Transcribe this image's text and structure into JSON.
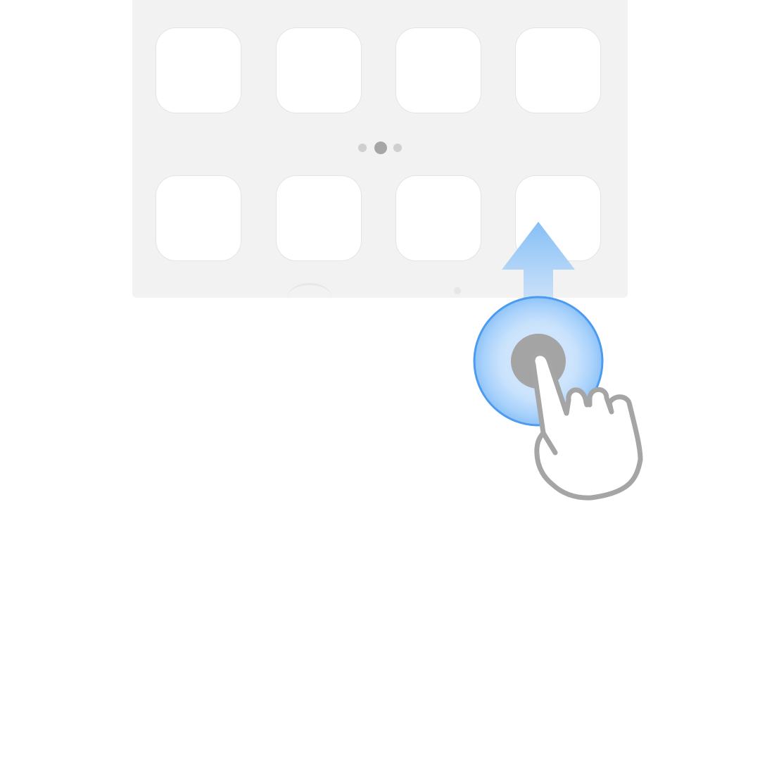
{
  "screen": {
    "tile_rows": 2,
    "tile_columns": 4,
    "page_indicator": {
      "page_count": 3,
      "active_page": 2
    }
  },
  "gesture": {
    "type": "swipe-up",
    "icons": [
      "hand-pointer-icon",
      "arrow-up-icon",
      "touch-ripple-icon"
    ]
  },
  "colors": {
    "screen_background": "#f2f2f2",
    "tile": "#ffffff",
    "dot_inactive": "#cfcfcf",
    "dot_active": "#a6a6a6",
    "arrow_light": "#d5e6fa",
    "arrow_dark": "#86bff5",
    "ripple_outer": "#4d9bf0",
    "ripple_inner": "#d9ebfd",
    "hand_stroke": "#a5a5a5"
  }
}
